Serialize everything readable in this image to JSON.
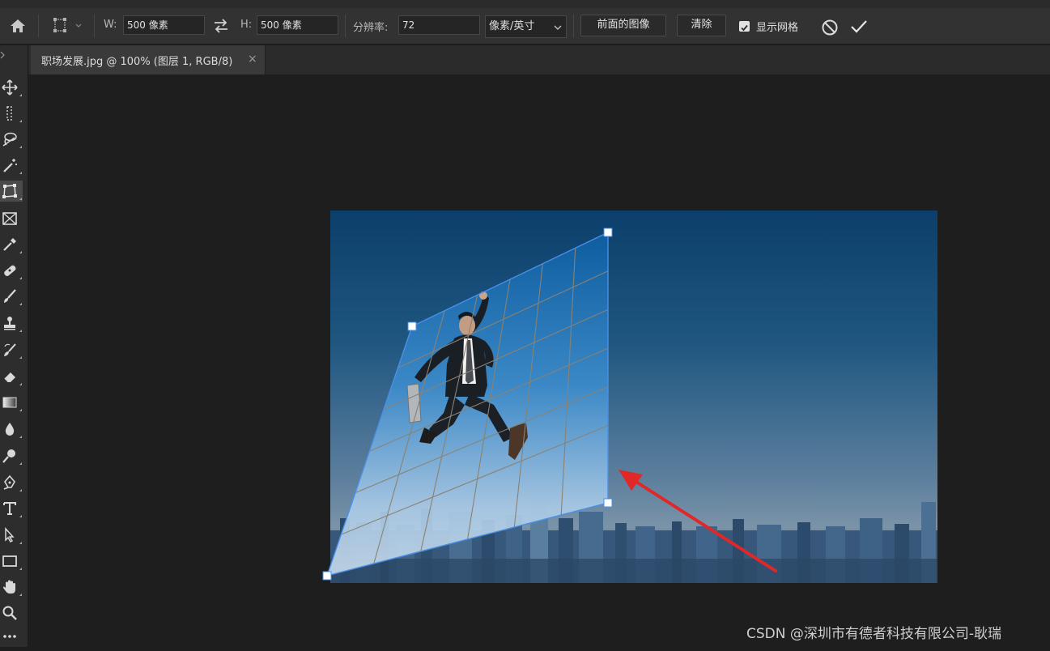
{
  "options_bar": {
    "width_label": "W:",
    "width_value": "500 像素",
    "height_label": "H:",
    "height_value": "500 像素",
    "resolution_label": "分辨率:",
    "resolution_value": "72",
    "unit_select": "像素/英寸",
    "front_image_button": "前面的图像",
    "clear_button": "清除",
    "show_grid_label": "显示网格",
    "show_grid_checked": true
  },
  "document_tab": {
    "title": "职场发展.jpg @ 100% (图层 1, RGB/8)",
    "close": "×"
  },
  "tools": [
    "move-tool",
    "marquee-tool",
    "lasso-tool",
    "magic-wand-tool",
    "crop-tool",
    "frame-tool",
    "eyedropper-tool",
    "healing-brush-tool",
    "brush-tool",
    "clone-stamp-tool",
    "history-brush-tool",
    "eraser-tool",
    "gradient-tool",
    "blur-tool",
    "dodge-tool",
    "pen-tool",
    "type-tool",
    "path-selection-tool",
    "rectangle-tool",
    "hand-tool",
    "zoom-tool",
    "more-tools"
  ],
  "active_tool": "crop-tool",
  "colors": {
    "sky_top": "#0c3f6b",
    "sky_bottom": "#6f8da8",
    "grid_line": "#8a8272",
    "frame_outline": "#4a8fe8",
    "arrow": "#e02828"
  },
  "watermark": "CSDN @深圳市有德者科技有限公司-耿瑞"
}
